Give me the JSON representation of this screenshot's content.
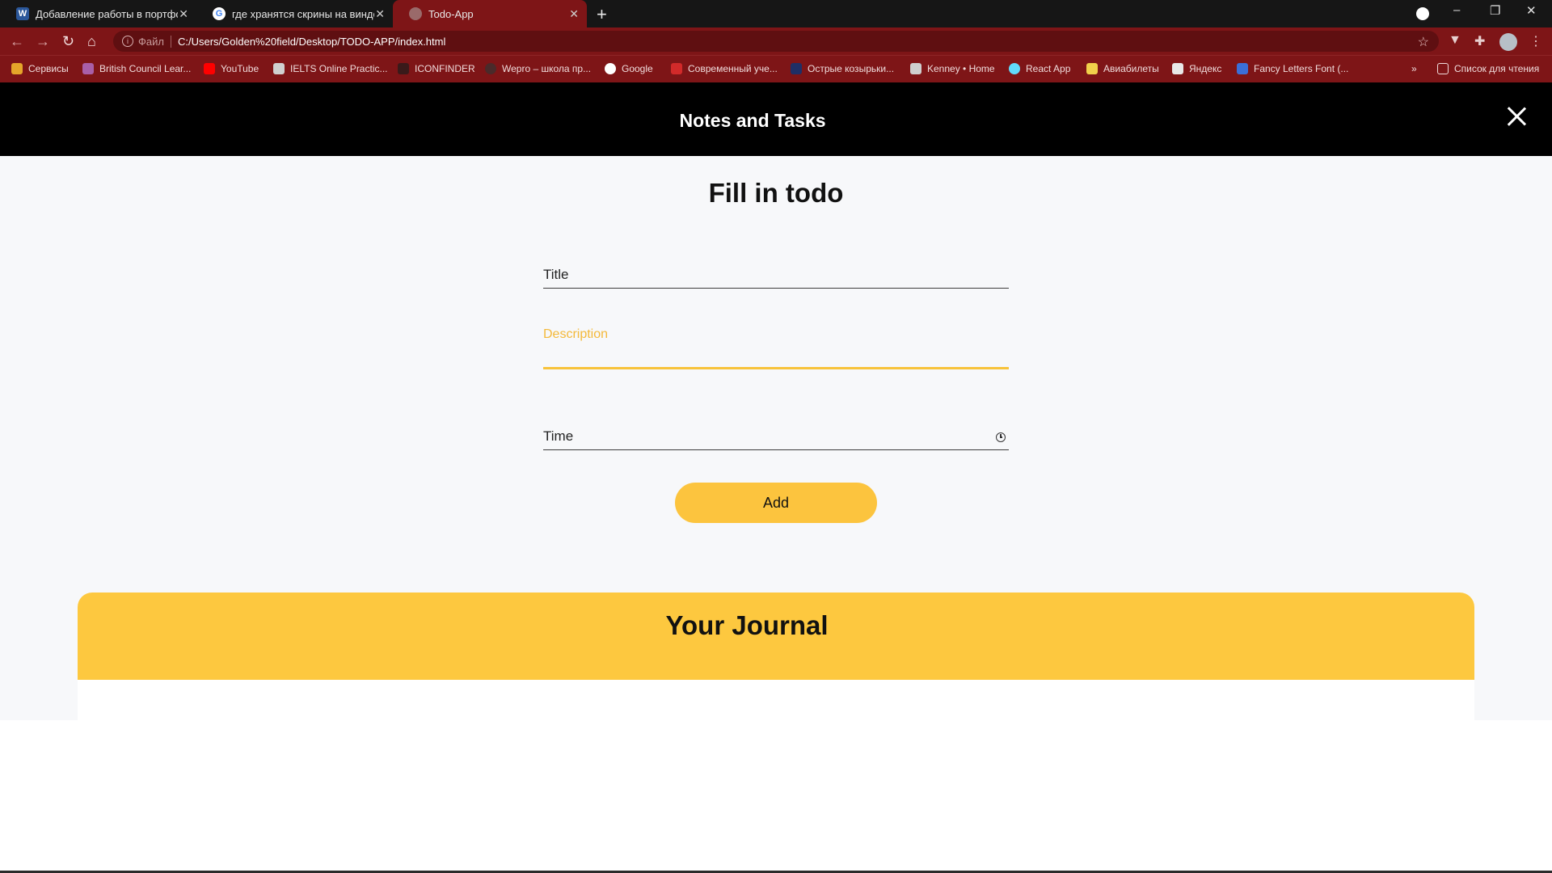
{
  "browser": {
    "tabs": [
      {
        "title": "Добавление работы в портфолио",
        "icon": "word-icon"
      },
      {
        "title": "где хранятся скрины на виндоус",
        "icon": "google-icon"
      },
      {
        "title": "Todo-App",
        "icon": "globe-icon"
      }
    ],
    "address": {
      "scheme": "Файл",
      "url": "C:/Users/Golden%20field/Desktop/TODO-APP/index.html"
    },
    "bookmarks": [
      "Сервисы",
      "British Council Lear...",
      "YouTube",
      "IELTS Online Practic...",
      "ICONFINDER",
      "Wepro – школа пр...",
      "Google",
      "Современный уче...",
      "Острые козырьки...",
      "Kenney • Home",
      "React App",
      "Авиабилеты",
      "Яндекс",
      "Fancy Letters Font (..."
    ],
    "reading_list": "Список для чтения",
    "more": "»"
  },
  "app": {
    "header_title": "Notes and Tasks",
    "form_heading": "Fill in todo",
    "fields": {
      "title_label": "Title",
      "description_label": "Description",
      "time_label": "Time"
    },
    "add_button": "Add",
    "journal_title": "Your Journal"
  },
  "colors": {
    "chrome_accent": "#7e1517",
    "tab_strip": "#161616",
    "header_bg": "#000000",
    "accent_yellow": "#fcc43e",
    "page_bg": "#f7f8fa"
  }
}
